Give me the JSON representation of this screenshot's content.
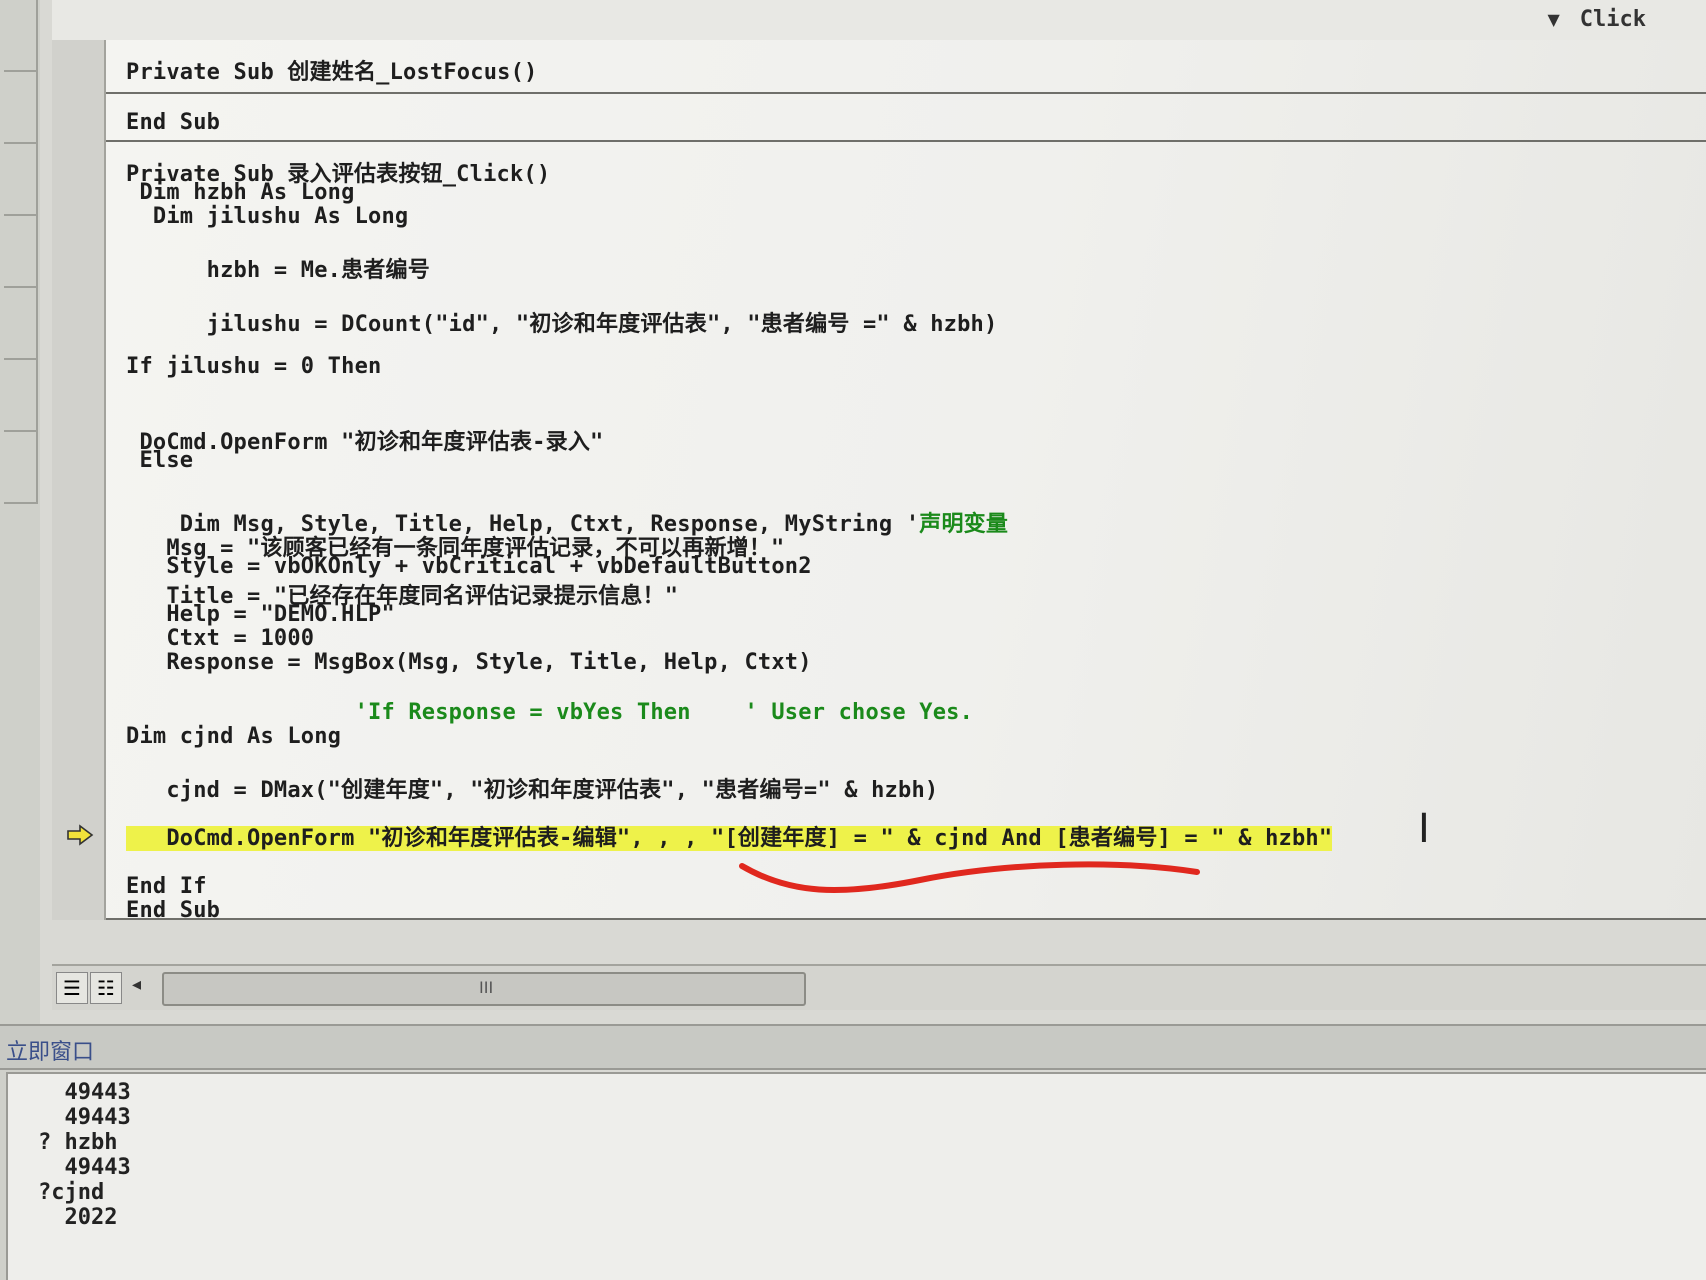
{
  "header": {
    "procedure_dropdown": {
      "arrow": "▼",
      "value": "Click"
    }
  },
  "code_lines": [
    {
      "id": "l1",
      "parts": [
        {
          "text": "Private Sub 创建姓名_LostFocus()"
        }
      ]
    },
    {
      "id": "l2",
      "parts": [
        {
          "text": "End Sub"
        }
      ]
    },
    {
      "id": "l3",
      "parts": [
        {
          "text": "Private Sub 录入评估表按钮_Click()"
        }
      ]
    },
    {
      "id": "l4",
      "parts": [
        {
          "text": " Dim hzbh As Long"
        }
      ]
    },
    {
      "id": "l5",
      "parts": [
        {
          "text": "  Dim jilushu As Long"
        }
      ]
    },
    {
      "id": "l6",
      "parts": [
        {
          "text": "      hzbh = Me.患者编号"
        }
      ]
    },
    {
      "id": "l7",
      "parts": [
        {
          "text": "      jilushu = DCount(\"id\", \"初诊和年度评估表\", \"患者编号 =\" & hzbh)"
        }
      ]
    },
    {
      "id": "l8",
      "parts": [
        {
          "text": "If jilushu = 0 Then"
        }
      ]
    },
    {
      "id": "l9",
      "parts": [
        {
          "text": " DoCmd.OpenForm \"初诊和年度评估表-录入\""
        }
      ]
    },
    {
      "id": "l10",
      "parts": [
        {
          "text": " Else"
        }
      ]
    },
    {
      "id": "l11",
      "parts": [
        {
          "text": "    Dim Msg, Style, Title, Help, Ctxt, Response, MyString '"
        },
        {
          "text": "声明变量",
          "cls": "comment"
        }
      ]
    },
    {
      "id": "l12",
      "parts": [
        {
          "text": "   Msg = \"该顾客已经有一条同年度评估记录，不可以再新增！\""
        }
      ]
    },
    {
      "id": "l13",
      "parts": [
        {
          "text": "   Style = vbOKOnly + vbCritical + vbDefaultButton2"
        }
      ]
    },
    {
      "id": "l14",
      "parts": [
        {
          "text": "   Title = \"已经存在年度同名评估记录提示信息！\""
        }
      ]
    },
    {
      "id": "l15",
      "parts": [
        {
          "text": "   Help = \"DEMO.HLP\""
        }
      ]
    },
    {
      "id": "l16",
      "parts": [
        {
          "text": "   Ctxt = 1000"
        }
      ]
    },
    {
      "id": "l17",
      "parts": [
        {
          "text": "   Response = MsgBox(Msg, Style, Title, Help, Ctxt)"
        }
      ]
    },
    {
      "id": "l18",
      "parts": [
        {
          "text": "                 'If Response = vbYes Then    ' User chose Yes.",
          "cls": "comment"
        }
      ]
    },
    {
      "id": "l19",
      "parts": [
        {
          "text": "Dim cjnd As Long"
        }
      ]
    },
    {
      "id": "l20",
      "parts": [
        {
          "text": "   cjnd = DMax(\"创建年度\", \"初诊和年度评估表\", \"患者编号=\" & hzbh)"
        }
      ]
    },
    {
      "id": "l21",
      "parts": [
        {
          "text": "   DoCmd.OpenForm \"初诊和年度评估表-编辑\", , , \"[创建年度] = \" & cjnd And [患者编号] = \" & hzbh\"",
          "cls": "hl"
        }
      ]
    },
    {
      "id": "l22",
      "parts": [
        {
          "text": "End If"
        }
      ]
    },
    {
      "id": "l23",
      "parts": [
        {
          "text": "End Sub"
        }
      ]
    }
  ],
  "immediate": {
    "title": "立即窗口",
    "lines": [
      "  49443",
      "  49443",
      "? hzbh",
      "  49443",
      "?cjnd",
      "  2022"
    ]
  },
  "scrollbar": {
    "grip": "III"
  },
  "icons": {
    "execution_arrow": "exec-arrow-icon",
    "text_cursor": "ibeam-icon",
    "dropdown_arrow": "chevron-down-icon",
    "scroll_left": "triangle-left-icon"
  },
  "colors": {
    "comment": "#1b8a1b",
    "highlight": "#eef24a",
    "annotation": "#e0281e"
  }
}
